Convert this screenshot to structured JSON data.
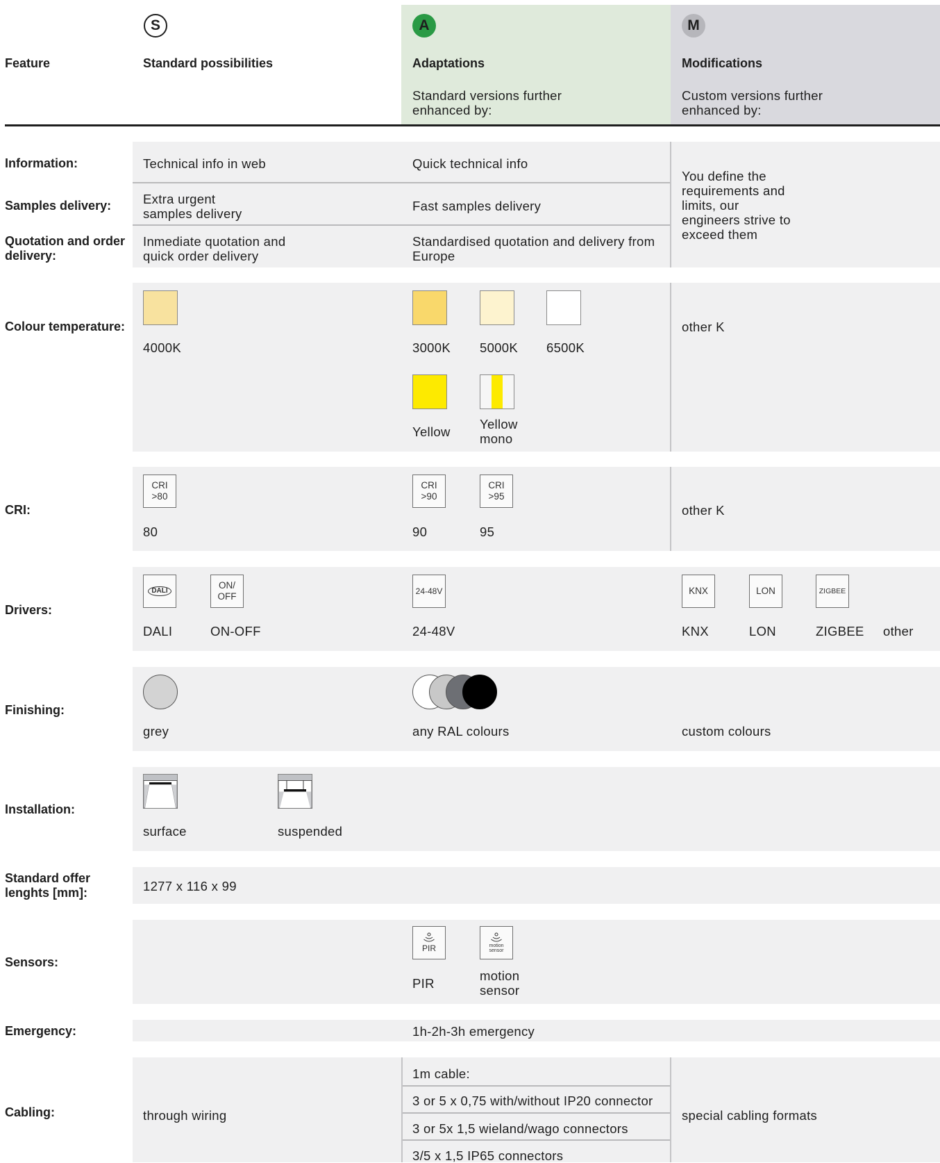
{
  "header": {
    "badges": {
      "s": "S",
      "a": "A",
      "m": "M"
    },
    "feature": "Feature",
    "standard": "Standard possibilities",
    "adaptations": "Adaptations",
    "adaptations_sub": "Standard versions further enhanced by:",
    "modifications": "Modifications",
    "modifications_sub": "Custom versions further enhanced by:"
  },
  "rows": {
    "information": {
      "label": "Information:",
      "standard": "Technical info in web",
      "adapt": "Quick technical info"
    },
    "samples": {
      "label": "Samples delivery:",
      "standard": "Extra urgent samples delivery",
      "adapt": "Fast samples delivery"
    },
    "quotation": {
      "label": "Quotation and order delivery:",
      "standard": "Inmediate quotation and quick order delivery",
      "adapt": "Standardised quotation and delivery from Europe"
    },
    "you_define": "You define the requirements and limits, our engineers strive to exceed them",
    "colour": {
      "label": "Colour temperature:",
      "s1": "4000K",
      "a1": "3000K",
      "a2": "5000K",
      "a3": "6500K",
      "a4": "Yellow",
      "a5": "Yellow mono",
      "mod": "other K",
      "swatch_colors": {
        "c4000": "#f8e29f",
        "c3000": "#f9d86b",
        "c5000": "#fdf3cf",
        "c6500": "#ffffff",
        "yellow": "#fdea00"
      }
    },
    "cri": {
      "label": "CRI:",
      "icon80": "CRI >80",
      "icon90": "CRI >90",
      "icon95": "CRI >95",
      "v80": "80",
      "v90": "90",
      "v95": "95",
      "mod": "other K"
    },
    "drivers": {
      "label": "Drivers:",
      "dali_icon": "DALI",
      "onoff_icon": "ON/ OFF",
      "v24_icon": "24-48V",
      "knx_icon": "KNX",
      "lon_icon": "LON",
      "zigbee_icon": "ZIGBEE",
      "dali": "DALI",
      "onoff": "ON-OFF",
      "v24": "24-48V",
      "knx": "KNX",
      "lon": "LON",
      "zigbee": "ZIGBEE",
      "other": "other"
    },
    "finishing": {
      "label": "Finishing:",
      "standard": "grey",
      "adapt": "any RAL colours",
      "mod": "custom colours"
    },
    "installation": {
      "label": "Installation:",
      "surface": "surface",
      "suspended": "suspended"
    },
    "lengths": {
      "label": "Standard offer lenghts [mm]:",
      "standard": "1277 x 116 x 99"
    },
    "sensors": {
      "label": "Sensors:",
      "pir_icon": "PIR",
      "motion_icon": "motion sensor",
      "pir": "PIR",
      "motion": "motion sensor"
    },
    "emergency": {
      "label": "Emergency:",
      "adapt": "1h-2h-3h emergency"
    },
    "cabling": {
      "label": "Cabling:",
      "standard": "through wiring",
      "adapt": [
        "1m cable:",
        "3 or 5 x 0,75 with/without IP20 connector",
        "3 or 5x 1,5 wieland/wago connectors",
        "3/5 x 1,5 IP65 connectors"
      ],
      "mod": "special cabling formats"
    }
  }
}
